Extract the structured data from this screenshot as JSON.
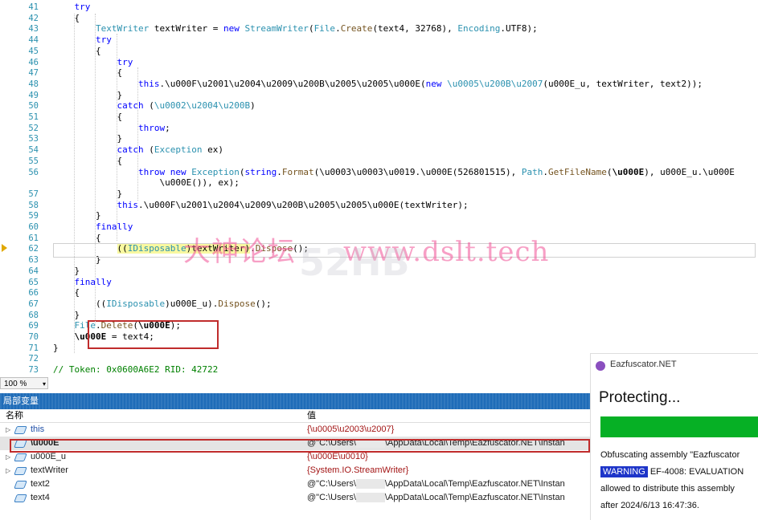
{
  "editor": {
    "lines": [
      {
        "num": "41",
        "indent": 2,
        "html": "<span class='kw'>try</span>"
      },
      {
        "num": "42",
        "indent": 2,
        "html": "{"
      },
      {
        "num": "43",
        "indent": 3,
        "html": "<span class='ty'>TextWriter</span> textWriter = <span class='kw'>new</span> <span class='ty'>StreamWriter</span>(<span class='ty'>File</span>.<span class='mth'>Create</span>(text4, 32768), <span class='ty'>Encoding</span>.UTF8);"
      },
      {
        "num": "44",
        "indent": 3,
        "html": "<span class='kw'>try</span>"
      },
      {
        "num": "45",
        "indent": 3,
        "html": "{"
      },
      {
        "num": "46",
        "indent": 4,
        "html": "<span class='kw'>try</span>"
      },
      {
        "num": "47",
        "indent": 4,
        "html": "{"
      },
      {
        "num": "48",
        "indent": 5,
        "html": "<span class='kw'>this</span>.\\u000F\\u2001\\u2004\\u2009\\u200B\\u2005\\u2005\\u000E(<span class='kw'>new</span> <span class='ty'>\\u0005\\u200B\\u2007</span>(u000E_u, textWriter, text2));"
      },
      {
        "num": "49",
        "indent": 4,
        "html": "}"
      },
      {
        "num": "50",
        "indent": 4,
        "html": "<span class='kw'>catch</span> (<span class='ty'>\\u0002\\u2004\\u200B</span>)"
      },
      {
        "num": "51",
        "indent": 4,
        "html": "{"
      },
      {
        "num": "52",
        "indent": 5,
        "html": "<span class='kw'>throw</span>;"
      },
      {
        "num": "53",
        "indent": 4,
        "html": "}"
      },
      {
        "num": "54",
        "indent": 4,
        "html": "<span class='kw'>catch</span> (<span class='ty'>Exception</span> ex)"
      },
      {
        "num": "55",
        "indent": 4,
        "html": "{"
      },
      {
        "num": "56",
        "indent": 5,
        "html": "<span class='kw'>throw</span> <span class='kw'>new</span> <span class='ty'>Exception</span>(<span class='kw'>string</span>.<span class='mth'>Format</span>(\\u0003\\u0003\\u0019.\\u000E(526801515), <span class='ty'>Path</span>.<span class='mth'>GetFileName</span>(<b>\\u000E</b>), u000E_u.\\u000E"
      },
      {
        "num": "",
        "indent": 6,
        "html": "\\u000E()), ex);"
      },
      {
        "num": "57",
        "indent": 4,
        "html": "}"
      },
      {
        "num": "58",
        "indent": 4,
        "html": "<span class='kw'>this</span>.\\u000F\\u2001\\u2004\\u2009\\u200B\\u2005\\u2005\\u000E(textWriter);"
      },
      {
        "num": "59",
        "indent": 3,
        "html": "}"
      },
      {
        "num": "60",
        "indent": 3,
        "html": "<span class='kw'>finally</span>"
      },
      {
        "num": "61",
        "indent": 3,
        "html": "{"
      },
      {
        "num": "62",
        "indent": 4,
        "html": "<span class='tok-hl'>((<span class='ty'>IDisposable</span>)textWriter)</span>.<span class='mth'>Dispose</span>();"
      },
      {
        "num": "63",
        "indent": 3,
        "html": "}"
      },
      {
        "num": "64",
        "indent": 2,
        "html": "}"
      },
      {
        "num": "65",
        "indent": 2,
        "html": "<span class='kw'>finally</span>"
      },
      {
        "num": "66",
        "indent": 2,
        "html": "{"
      },
      {
        "num": "67",
        "indent": 3,
        "html": "((<span class='ty'>IDisposable</span>)u000E_u).<span class='mth'>Dispose</span>();"
      },
      {
        "num": "68",
        "indent": 2,
        "html": "}"
      },
      {
        "num": "69",
        "indent": 2,
        "html": "<span class='ty'>File</span>.<span class='mth'>Delete</span>(<b>\\u000E</b>);"
      },
      {
        "num": "70",
        "indent": 2,
        "html": "<b>\\u000E</b> = text4;"
      },
      {
        "num": "71",
        "indent": 1,
        "html": "}"
      },
      {
        "num": "72",
        "indent": 1,
        "html": ""
      },
      {
        "num": "73",
        "indent": 1,
        "html": "<span class='cm'>// Token: 0x0600A6E2 RID: 42722</span>"
      }
    ]
  },
  "zoom": {
    "value": "100 %",
    "dropdown": "▾"
  },
  "locals": {
    "title": "局部变量",
    "col_name": "名称",
    "col_value": "值",
    "rows": [
      {
        "expand": "▷",
        "name": "this",
        "value_parts": [
          "{\\u0005\\u2003\\u2007}"
        ],
        "value_color": "#a31515"
      },
      {
        "expand": "",
        "name": "\\u000E",
        "value_parts": [
          "@\"C:\\Users\\",
          "\\AppData\\Local\\Temp\\Eazfuscator.NET\\Instan"
        ],
        "value_color": "#1a1a1a"
      },
      {
        "expand": "▷",
        "name": "u000E_u",
        "value_parts": [
          "{\\u000E\\u0010}"
        ],
        "value_color": "#a31515"
      },
      {
        "expand": "▷",
        "name": "textWriter",
        "value_parts": [
          "{System.IO.StreamWriter}"
        ],
        "value_color": "#a31515"
      },
      {
        "expand": "",
        "name": "text2",
        "value_parts": [
          "@\"C:\\Users\\",
          "\\AppData\\Local\\Temp\\Eazfuscator.NET\\Instan"
        ],
        "value_color": "#1a1a1a"
      },
      {
        "expand": "",
        "name": "text4",
        "value_parts": [
          "@\"C:\\Users\\",
          "\\AppData\\Local\\Temp\\Eazfuscator.NET\\Instan"
        ],
        "value_color": "#1a1a1a"
      }
    ]
  },
  "toast": {
    "app_name": "Eazfuscator.NET",
    "title": "Protecting...",
    "progress": 1.0,
    "line1": "Obfuscating assembly \"Eazfuscator",
    "warning_badge": "WARNING",
    "line2_rest": " EF-4008: EVALUATION",
    "line3": "allowed to distribute this assembly",
    "line4": "after 2024/6/13 16:47:36."
  },
  "watermark": {
    "text": "大神论坛     www.dslt.tech",
    "logo_text": "52HB"
  },
  "colors": {
    "accent": "#1f6cb8",
    "progress": "#06b025",
    "warning": "#1e35c9",
    "highlight": "#c02c2c"
  }
}
